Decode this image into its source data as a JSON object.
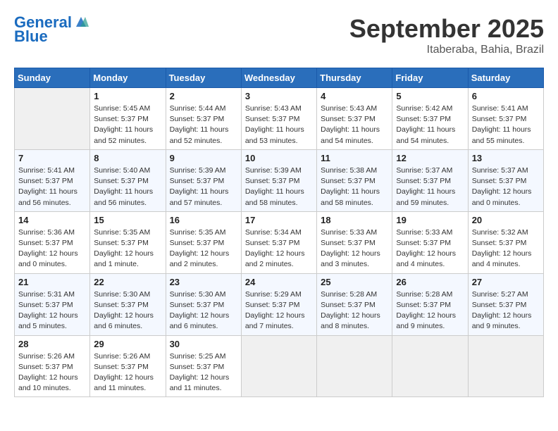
{
  "header": {
    "logo_line1": "General",
    "logo_line2": "Blue",
    "month": "September 2025",
    "location": "Itaberaba, Bahia, Brazil"
  },
  "columns": [
    "Sunday",
    "Monday",
    "Tuesday",
    "Wednesday",
    "Thursday",
    "Friday",
    "Saturday"
  ],
  "weeks": [
    [
      {
        "day": "",
        "info": ""
      },
      {
        "day": "1",
        "info": "Sunrise: 5:45 AM\nSunset: 5:37 PM\nDaylight: 11 hours\nand 52 minutes."
      },
      {
        "day": "2",
        "info": "Sunrise: 5:44 AM\nSunset: 5:37 PM\nDaylight: 11 hours\nand 52 minutes."
      },
      {
        "day": "3",
        "info": "Sunrise: 5:43 AM\nSunset: 5:37 PM\nDaylight: 11 hours\nand 53 minutes."
      },
      {
        "day": "4",
        "info": "Sunrise: 5:43 AM\nSunset: 5:37 PM\nDaylight: 11 hours\nand 54 minutes."
      },
      {
        "day": "5",
        "info": "Sunrise: 5:42 AM\nSunset: 5:37 PM\nDaylight: 11 hours\nand 54 minutes."
      },
      {
        "day": "6",
        "info": "Sunrise: 5:41 AM\nSunset: 5:37 PM\nDaylight: 11 hours\nand 55 minutes."
      }
    ],
    [
      {
        "day": "7",
        "info": "Sunrise: 5:41 AM\nSunset: 5:37 PM\nDaylight: 11 hours\nand 56 minutes."
      },
      {
        "day": "8",
        "info": "Sunrise: 5:40 AM\nSunset: 5:37 PM\nDaylight: 11 hours\nand 56 minutes."
      },
      {
        "day": "9",
        "info": "Sunrise: 5:39 AM\nSunset: 5:37 PM\nDaylight: 11 hours\nand 57 minutes."
      },
      {
        "day": "10",
        "info": "Sunrise: 5:39 AM\nSunset: 5:37 PM\nDaylight: 11 hours\nand 58 minutes."
      },
      {
        "day": "11",
        "info": "Sunrise: 5:38 AM\nSunset: 5:37 PM\nDaylight: 11 hours\nand 58 minutes."
      },
      {
        "day": "12",
        "info": "Sunrise: 5:37 AM\nSunset: 5:37 PM\nDaylight: 11 hours\nand 59 minutes."
      },
      {
        "day": "13",
        "info": "Sunrise: 5:37 AM\nSunset: 5:37 PM\nDaylight: 12 hours\nand 0 minutes."
      }
    ],
    [
      {
        "day": "14",
        "info": "Sunrise: 5:36 AM\nSunset: 5:37 PM\nDaylight: 12 hours\nand 0 minutes."
      },
      {
        "day": "15",
        "info": "Sunrise: 5:35 AM\nSunset: 5:37 PM\nDaylight: 12 hours\nand 1 minute."
      },
      {
        "day": "16",
        "info": "Sunrise: 5:35 AM\nSunset: 5:37 PM\nDaylight: 12 hours\nand 2 minutes."
      },
      {
        "day": "17",
        "info": "Sunrise: 5:34 AM\nSunset: 5:37 PM\nDaylight: 12 hours\nand 2 minutes."
      },
      {
        "day": "18",
        "info": "Sunrise: 5:33 AM\nSunset: 5:37 PM\nDaylight: 12 hours\nand 3 minutes."
      },
      {
        "day": "19",
        "info": "Sunrise: 5:33 AM\nSunset: 5:37 PM\nDaylight: 12 hours\nand 4 minutes."
      },
      {
        "day": "20",
        "info": "Sunrise: 5:32 AM\nSunset: 5:37 PM\nDaylight: 12 hours\nand 4 minutes."
      }
    ],
    [
      {
        "day": "21",
        "info": "Sunrise: 5:31 AM\nSunset: 5:37 PM\nDaylight: 12 hours\nand 5 minutes."
      },
      {
        "day": "22",
        "info": "Sunrise: 5:30 AM\nSunset: 5:37 PM\nDaylight: 12 hours\nand 6 minutes."
      },
      {
        "day": "23",
        "info": "Sunrise: 5:30 AM\nSunset: 5:37 PM\nDaylight: 12 hours\nand 6 minutes."
      },
      {
        "day": "24",
        "info": "Sunrise: 5:29 AM\nSunset: 5:37 PM\nDaylight: 12 hours\nand 7 minutes."
      },
      {
        "day": "25",
        "info": "Sunrise: 5:28 AM\nSunset: 5:37 PM\nDaylight: 12 hours\nand 8 minutes."
      },
      {
        "day": "26",
        "info": "Sunrise: 5:28 AM\nSunset: 5:37 PM\nDaylight: 12 hours\nand 9 minutes."
      },
      {
        "day": "27",
        "info": "Sunrise: 5:27 AM\nSunset: 5:37 PM\nDaylight: 12 hours\nand 9 minutes."
      }
    ],
    [
      {
        "day": "28",
        "info": "Sunrise: 5:26 AM\nSunset: 5:37 PM\nDaylight: 12 hours\nand 10 minutes."
      },
      {
        "day": "29",
        "info": "Sunrise: 5:26 AM\nSunset: 5:37 PM\nDaylight: 12 hours\nand 11 minutes."
      },
      {
        "day": "30",
        "info": "Sunrise: 5:25 AM\nSunset: 5:37 PM\nDaylight: 12 hours\nand 11 minutes."
      },
      {
        "day": "",
        "info": ""
      },
      {
        "day": "",
        "info": ""
      },
      {
        "day": "",
        "info": ""
      },
      {
        "day": "",
        "info": ""
      }
    ]
  ]
}
